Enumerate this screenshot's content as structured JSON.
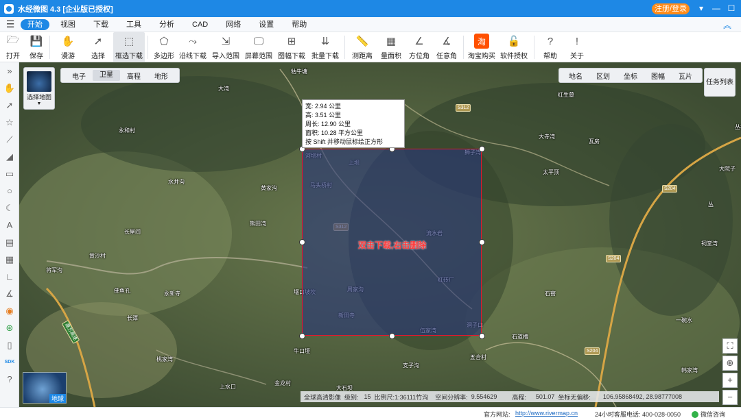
{
  "app": {
    "title": "水经微图 4.3 [企业版已授权]",
    "login_label": "注册/登录",
    "window_buttons": {
      "menu": "▾",
      "minimize": "—",
      "maximize": "☐",
      "close": "✕"
    }
  },
  "menubar": {
    "items": [
      {
        "label": "开始",
        "active": true
      },
      {
        "label": "视图"
      },
      {
        "label": "下载"
      },
      {
        "label": "工具"
      },
      {
        "label": "分析"
      },
      {
        "label": "CAD"
      },
      {
        "label": "网络"
      },
      {
        "label": "设置"
      },
      {
        "label": "帮助"
      }
    ]
  },
  "toolbar": {
    "items": [
      {
        "label": "打开",
        "icon": "folder-icon",
        "glyph": "🗁"
      },
      {
        "label": "保存",
        "icon": "save-icon",
        "glyph": "💾"
      },
      {
        "label": "漫游",
        "icon": "hand-icon",
        "glyph": "✋"
      },
      {
        "label": "选择",
        "icon": "cursor-icon",
        "glyph": "➚"
      },
      {
        "label": "框选下载",
        "icon": "rect-download-icon",
        "glyph": "⬚",
        "selected": true
      },
      {
        "label": "多边形",
        "icon": "polygon-icon",
        "glyph": "⬠"
      },
      {
        "label": "沿线下载",
        "icon": "line-download-icon",
        "glyph": "⤳"
      },
      {
        "label": "导入范围",
        "icon": "import-range-icon",
        "glyph": "⇲"
      },
      {
        "label": "屏幕范围",
        "icon": "screen-range-icon",
        "glyph": "🖵"
      },
      {
        "label": "图幅下载",
        "icon": "sheet-download-icon",
        "glyph": "⊞"
      },
      {
        "label": "批量下载",
        "icon": "batch-download-icon",
        "glyph": "⇊"
      },
      {
        "label": "测距离",
        "icon": "ruler-icon",
        "glyph": "📏"
      },
      {
        "label": "量面积",
        "icon": "area-icon",
        "glyph": "▦"
      },
      {
        "label": "方位角",
        "icon": "azimuth-icon",
        "glyph": "∠"
      },
      {
        "label": "任意角",
        "icon": "angle-icon",
        "glyph": "∡"
      },
      {
        "label": "淘宝购买",
        "icon": "taobao-icon",
        "glyph": "淘"
      },
      {
        "label": "软件授权",
        "icon": "license-icon",
        "glyph": "🔓"
      },
      {
        "label": "帮助",
        "icon": "help-icon",
        "glyph": "?"
      },
      {
        "label": "关于",
        "icon": "info-icon",
        "glyph": "!"
      }
    ]
  },
  "map": {
    "select_map_label": "选择地图",
    "map_types": [
      "电子",
      "卫星",
      "高程",
      "地形"
    ],
    "right_tools": [
      "地名",
      "区划",
      "坐标",
      "图幅",
      "瓦片"
    ],
    "task_list_label": "任务列表",
    "minimap_label": "地球",
    "tooltip": {
      "width": "宽: 2.94 公里",
      "height": "高: 3.51 公里",
      "perimeter": "周长: 12.90 公里",
      "area": "面积: 10.28 平方公里",
      "hint": "按 Shift 并移动鼠标绘正方形"
    },
    "selection_hint": "双击下载,右击删除",
    "place_names": [
      "牯牛塘",
      "大湾",
      "永和村",
      "水井沟",
      "长屋间",
      "黄沙村",
      "将军沟",
      "佛鱼孔",
      "永新寺",
      "长潭",
      "桃家湾",
      "上水口",
      "金龙村",
      "牛口垭",
      "大石坝",
      "支子沟",
      "五合村",
      "石道槽",
      "韩家湾",
      "一碗水",
      "石窖",
      "祠堂湾",
      "丛",
      "大院子",
      "丛林镇",
      "瓦房",
      "大寺湾",
      "太平顶",
      "红生墓",
      "狮子湾",
      "上坝",
      "河坝村",
      "马头桥村",
      "黄家沟",
      "熊田湾",
      "流水岩",
      "红砖厂",
      "堰口坡坎",
      "周家沟",
      "新田寺",
      "伍家湾",
      "洞子口"
    ],
    "roads": [
      "S312",
      "S312",
      "S204",
      "S204",
      "S204",
      "遵万高速"
    ]
  },
  "status": {
    "source": "全球高清影像",
    "level_label": "级别:",
    "level": "15",
    "scale_label": "比例尺:",
    "scale": "1:36111竹沟",
    "resolution_label": "空间分辨率:",
    "resolution": "9.554629",
    "elevation_label": "高程:",
    "elevation": "501.07",
    "coord_label": "坐标无偏移:",
    "coord": "106.95868492, 28.98777008"
  },
  "footer": {
    "website_label": "官方网站:",
    "website": "http://www.rivermap.cn",
    "phone": "24小时客服电话: 400-028-0050",
    "wechat": "微信咨询"
  },
  "colors": {
    "accent": "#1e88e5",
    "login": "#ff8c1a",
    "selection_border": "#e8142e"
  }
}
